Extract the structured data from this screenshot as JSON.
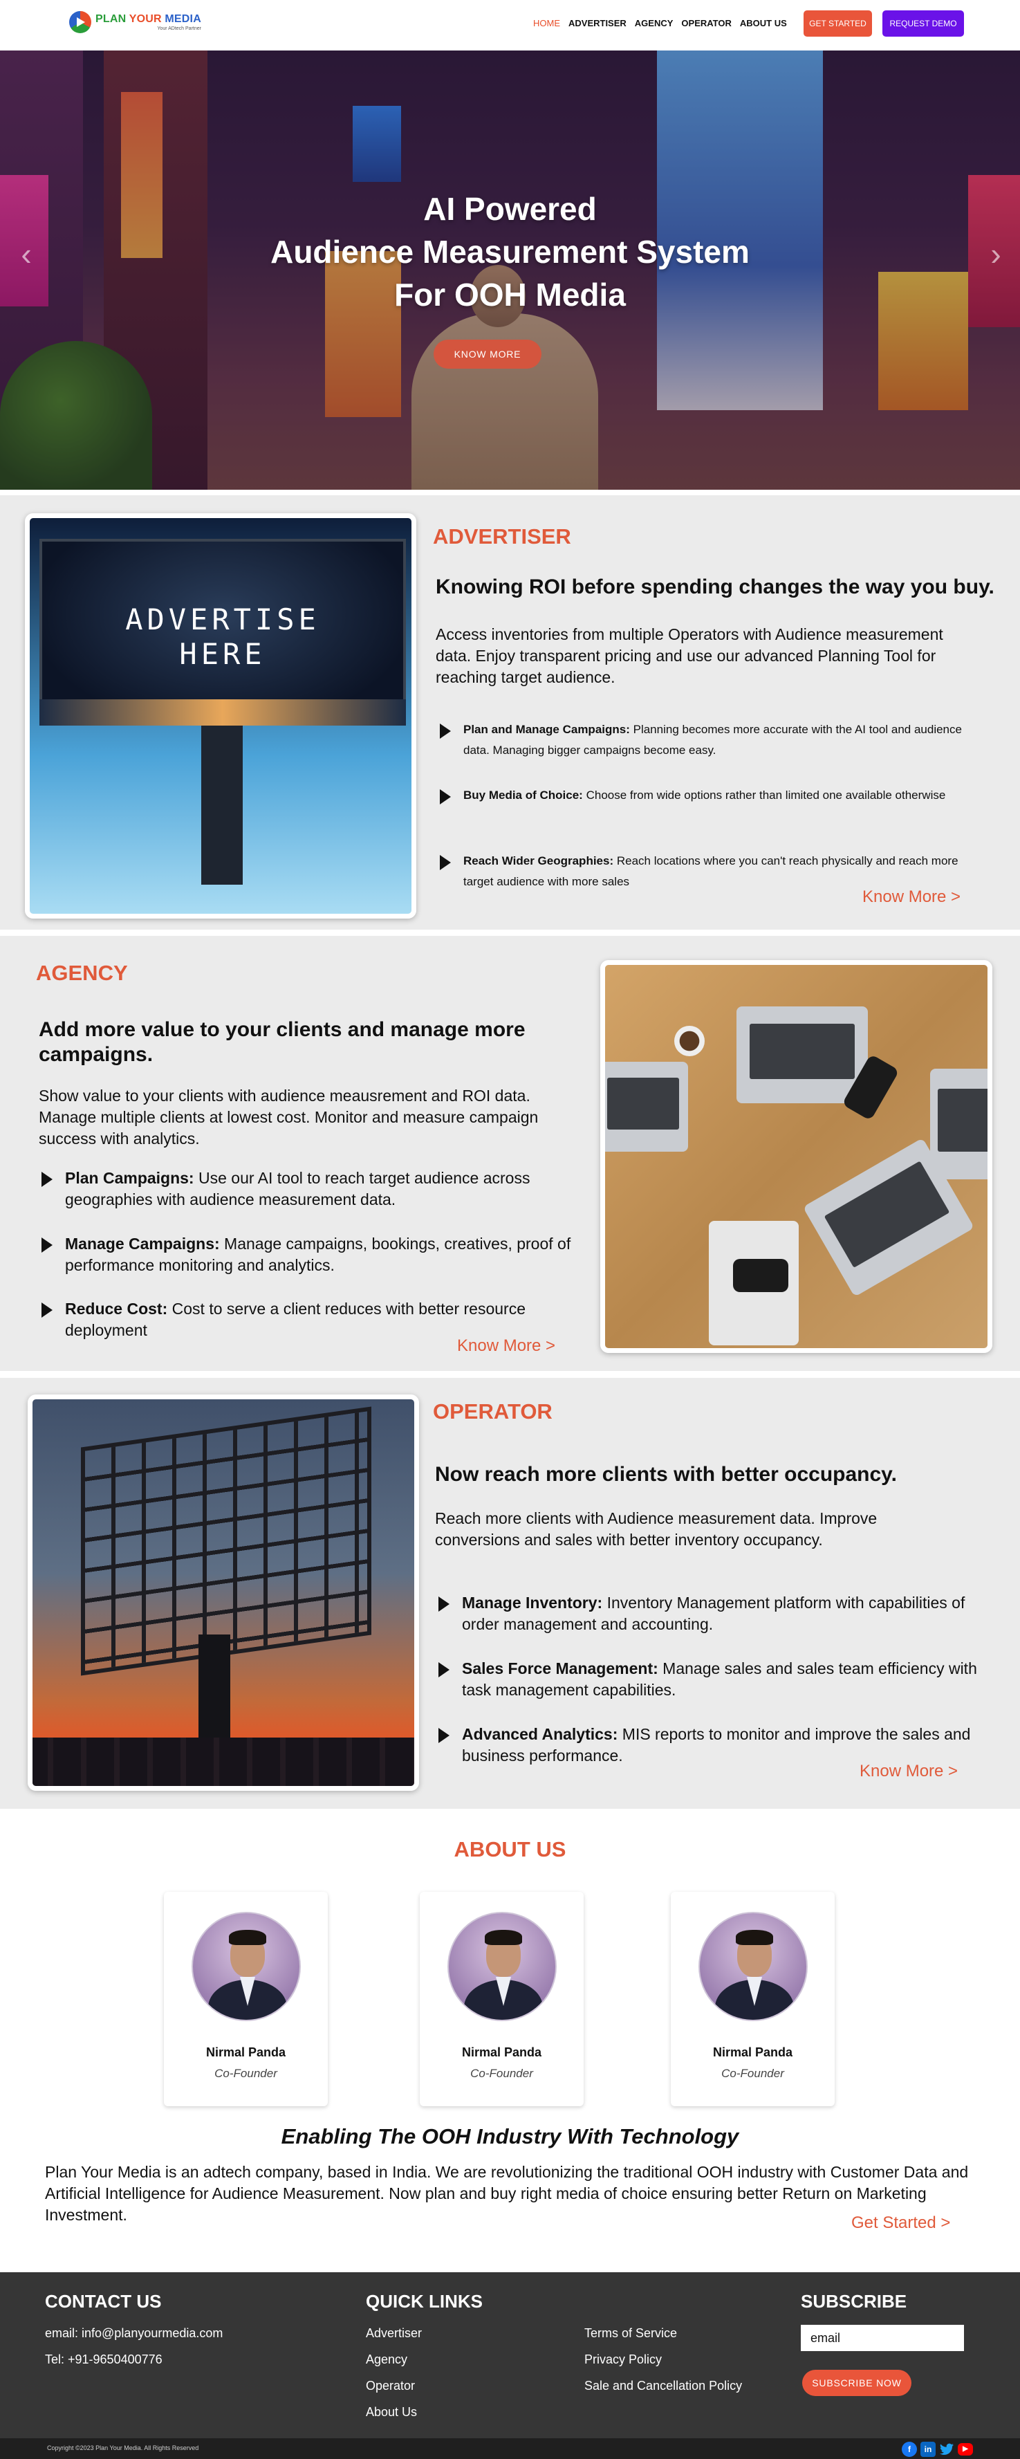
{
  "navbar": {
    "logo": {
      "word1": "PLAN",
      "word2": "YOUR",
      "word3": "MEDIA",
      "tagline": "Your ADtech Partner"
    },
    "links": [
      "HOME",
      "ADVERTISER",
      "AGENCY",
      "OPERATOR",
      "ABOUT US"
    ],
    "get_started": "GET STARTED",
    "request_demo": "REQUEST DEMO",
    "colors": {
      "accent": "#e9553a",
      "demo": "#6a12e8"
    }
  },
  "hero": {
    "title_lines": [
      "AI Powered",
      "Audience Measurement System",
      "For OOH Media"
    ],
    "button": "KNOW MORE",
    "prev_icon": "chevron-left-icon",
    "next_icon": "chevron-right-icon"
  },
  "advertiser": {
    "title": "ADVERTISER",
    "headline": "Knowing ROI before spending changes the way you buy.",
    "paragraph": "Access inventories from multiple Operators with Audience measurement data. Enjoy transparent pricing and use our advanced Planning Tool for reaching target audience.",
    "image_text": [
      "ADVERTISE",
      "HERE"
    ],
    "features": [
      {
        "head": "Plan and Manage Campaigns:",
        "text": " Planning becomes more accurate with the AI tool and audience data. Managing bigger campaigns become easy."
      },
      {
        "head": "Buy Media of Choice:",
        "text": " Choose from wide options rather than limited one available otherwise"
      },
      {
        "head": "Reach Wider Geographies:",
        "text": " Reach locations where you can't reach physically and reach more target audience with more sales"
      }
    ],
    "know_more": "Know More >"
  },
  "agency": {
    "title": "AGENCY",
    "headline": "Add more value to your clients and manage more campaigns.",
    "paragraph": "Show value to your clients with audience meausrement and ROI data. Manage multiple clients at lowest cost. Monitor and measure campaign success with analytics.",
    "features": [
      {
        "head": "Plan Campaigns:",
        "text": " Use our AI tool to reach target audience across geographies with audience measurement data."
      },
      {
        "head": "Manage Campaigns:",
        "text": " Manage campaigns, bookings, creatives, proof of performance monitoring and analytics."
      },
      {
        "head": "Reduce Cost:",
        "text": " Cost to serve a client reduces with better resource deployment"
      }
    ],
    "know_more": "Know More >"
  },
  "operator": {
    "title": "OPERATOR",
    "headline": "Now reach more clients with better occupancy.",
    "paragraph": "Reach more clients with Audience measurement data. Improve conversions and sales with better inventory occupancy.",
    "features": [
      {
        "head": "Manage Inventory:",
        "text": " Inventory Management platform with capabilities of order management and accounting."
      },
      {
        "head": "Sales Force Management:",
        "text": " Manage sales and sales team efficiency with task management capabilities."
      },
      {
        "head": "Advanced Analytics:",
        "text": " MIS reports to monitor and improve the sales and business performance."
      }
    ],
    "know_more": "Know More >"
  },
  "about": {
    "title": "ABOUT US",
    "members": [
      {
        "name": "Nirmal Panda",
        "role": "Co-Founder"
      },
      {
        "name": "Nirmal Panda",
        "role": "Co-Founder"
      },
      {
        "name": "Nirmal Panda",
        "role": "Co-Founder"
      }
    ],
    "tagline": "Enabling The OOH Industry With Technology",
    "paragraph": "Plan Your Media is an adtech company, based in India. We are revolutionizing the traditional OOH industry with Customer Data and Artificial Intelligence for Audience Measurement. Now plan and buy right media of choice ensuring better Return on Marketing Investment.",
    "cta": "Get Started >"
  },
  "footer": {
    "contact_title": "CONTACT US",
    "email": "email: info@planyourmedia.com",
    "tel": "Tel: +91-9650400776",
    "quick_links_title": "QUICK LINKS",
    "links_col1": [
      "Advertiser",
      "Agency",
      "Operator",
      "About Us"
    ],
    "links_col2": [
      "Terms of Service",
      "Privacy Policy",
      "Sale and Cancellation Policy"
    ],
    "subscribe_title": "SUBSCRIBE",
    "email_placeholder": "email",
    "subscribe_button": "SUBSCRIBE NOW",
    "copyright": "Copyright ©2023 Plan Your Media. All Rights Reserved",
    "social": [
      {
        "icon": "facebook-icon",
        "color": "#1877f2"
      },
      {
        "icon": "linkedin-icon",
        "color": "#0a66c2"
      },
      {
        "icon": "twitter-icon",
        "color": "#1da1f2"
      },
      {
        "icon": "youtube-icon",
        "color": "#ff0000"
      }
    ]
  }
}
